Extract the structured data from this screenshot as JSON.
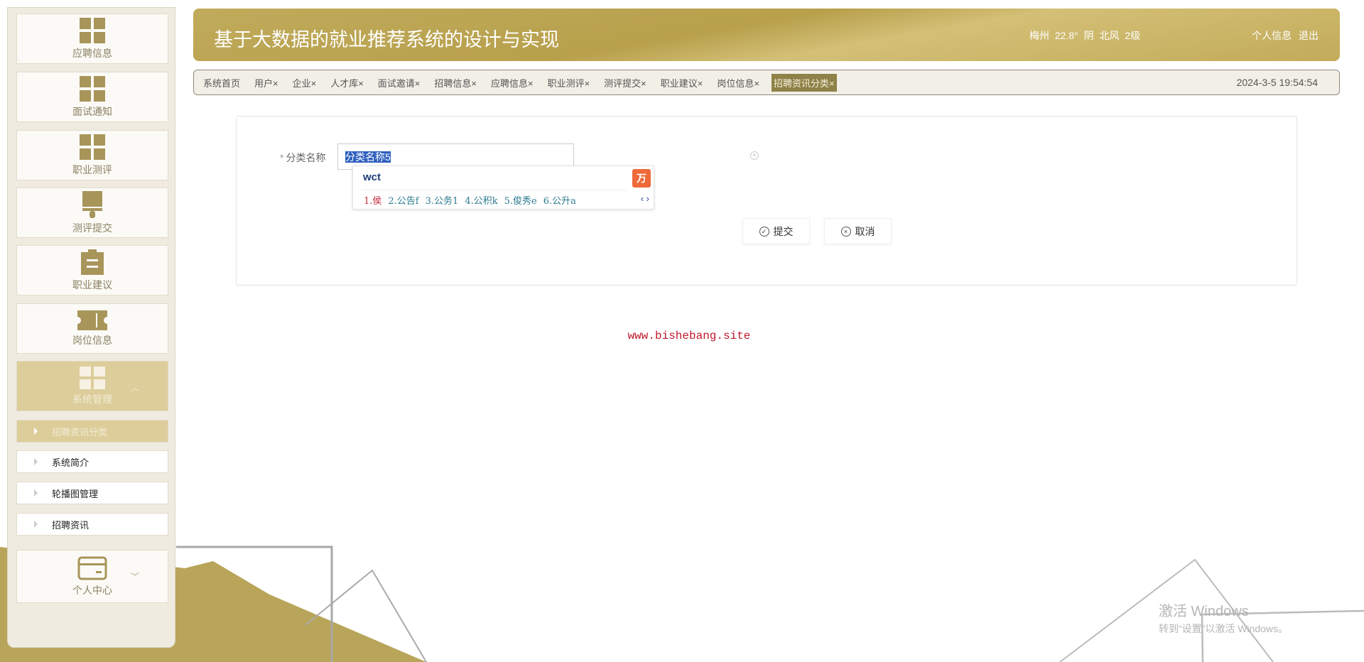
{
  "sidebar": {
    "items": [
      {
        "label": "应聘信息",
        "icon": "grid-icon"
      },
      {
        "label": "面试通知",
        "icon": "grid-icon"
      },
      {
        "label": "职业测评",
        "icon": "grid-icon"
      },
      {
        "label": "测评提交",
        "icon": "brush-icon"
      },
      {
        "label": "职业建议",
        "icon": "clipboard-icon"
      },
      {
        "label": "岗位信息",
        "icon": "ticket-icon"
      },
      {
        "label": "系统管理",
        "icon": "grid-icon",
        "expanded": true
      }
    ],
    "subitems": [
      "招聘资讯分类",
      "系统简介",
      "轮播图管理",
      "招聘资讯"
    ],
    "personal": {
      "label": "个人中心",
      "icon": "card-icon"
    }
  },
  "header": {
    "title": "基于大数据的就业推荐系统的设计与实现",
    "weather": "梅州 22.8° 阴 北风 2级",
    "profile": "个人信息",
    "logout": "退出"
  },
  "tabs": {
    "items": [
      "系统首页",
      "用户×",
      "企业×",
      "人才库×",
      "面试邀请×",
      "招聘信息×",
      "应聘信息×",
      "职业测评×",
      "测评提交×",
      "职业建议×",
      "岗位信息×",
      "招聘资讯分类×"
    ],
    "datetime": "2024-3-5 19:54:54"
  },
  "form": {
    "label": "分类名称",
    "required_mark": "*",
    "value": "分类名称5",
    "submit": "提交",
    "cancel": "取消"
  },
  "ime": {
    "composition": "wct",
    "candidates": [
      "1.侯",
      "2.公告f",
      "3.公务1",
      "4.公积k",
      "5.俊秀e",
      "6.公升a"
    ],
    "logo": "万"
  },
  "watermark": "www.bishebang.site",
  "windows": {
    "line1": "激活 Windows",
    "line2": "转到“设置”以激活 Windows。"
  },
  "colors": {
    "accent": "#b8a04c",
    "active_tab": "#8f8147",
    "watermark": "#c0182d"
  }
}
